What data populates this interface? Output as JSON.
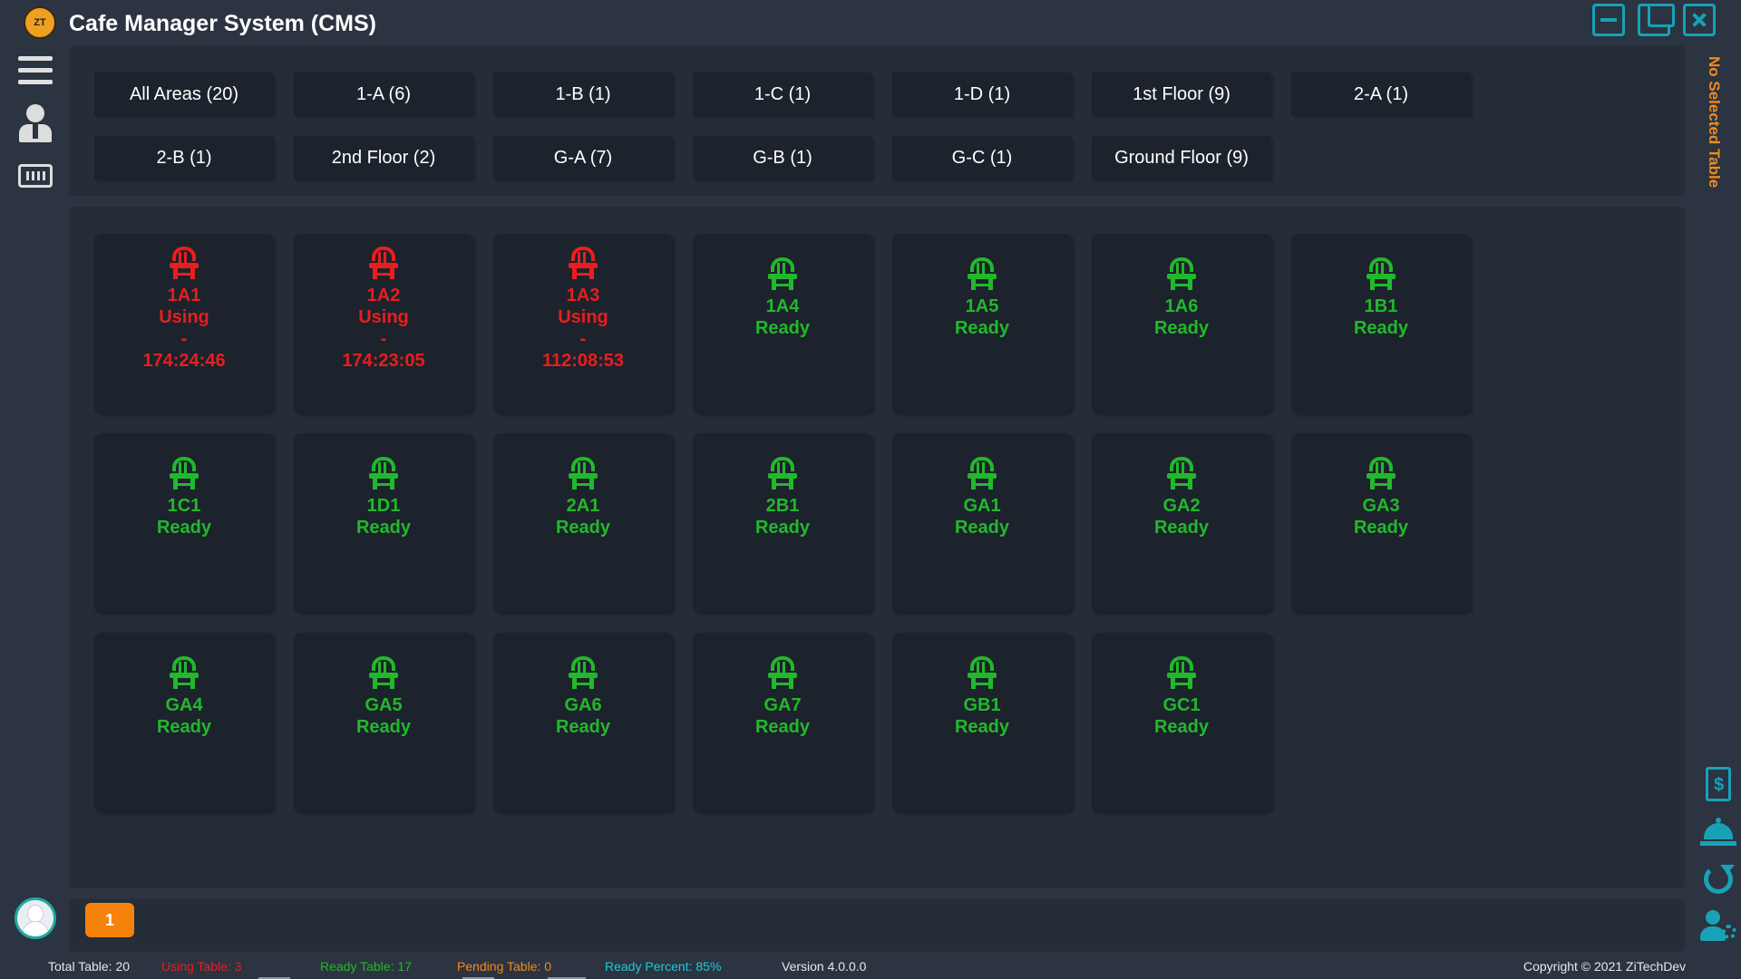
{
  "app": {
    "title": "Cafe Manager System (CMS)",
    "logo_text": "ZT"
  },
  "areas": [
    {
      "label": "All Areas (20)"
    },
    {
      "label": "1-A (6)"
    },
    {
      "label": "1-B (1)"
    },
    {
      "label": "1-C (1)"
    },
    {
      "label": "1-D (1)"
    },
    {
      "label": "1st Floor (9)"
    },
    {
      "label": "2-A (1)"
    },
    {
      "label": "2-B (1)"
    },
    {
      "label": "2nd Floor (2)"
    },
    {
      "label": "G-A (7)"
    },
    {
      "label": "G-B (1)"
    },
    {
      "label": "G-C (1)"
    },
    {
      "label": "Ground Floor (9)"
    }
  ],
  "tables": [
    {
      "name": "1A1",
      "status": "Using",
      "sep": "-",
      "time": "174:24:46"
    },
    {
      "name": "1A2",
      "status": "Using",
      "sep": "-",
      "time": "174:23:05"
    },
    {
      "name": "1A3",
      "status": "Using",
      "sep": "-",
      "time": "112:08:53"
    },
    {
      "name": "1A4",
      "status": "Ready"
    },
    {
      "name": "1A5",
      "status": "Ready"
    },
    {
      "name": "1A6",
      "status": "Ready"
    },
    {
      "name": "1B1",
      "status": "Ready"
    },
    {
      "name": "1C1",
      "status": "Ready"
    },
    {
      "name": "1D1",
      "status": "Ready"
    },
    {
      "name": "2A1",
      "status": "Ready"
    },
    {
      "name": "2B1",
      "status": "Ready"
    },
    {
      "name": "GA1",
      "status": "Ready"
    },
    {
      "name": "GA2",
      "status": "Ready"
    },
    {
      "name": "GA3",
      "status": "Ready"
    },
    {
      "name": "GA4",
      "status": "Ready"
    },
    {
      "name": "GA5",
      "status": "Ready"
    },
    {
      "name": "GA6",
      "status": "Ready"
    },
    {
      "name": "GA7",
      "status": "Ready"
    },
    {
      "name": "GB1",
      "status": "Ready"
    },
    {
      "name": "GC1",
      "status": "Ready"
    }
  ],
  "side": {
    "no_selected": "No Selected Table"
  },
  "pagination": {
    "current": "1"
  },
  "status_bar": {
    "total": "Total Table: 20",
    "using": "Using Table: 3",
    "ready": "Ready Table: 17",
    "pending": "Pending Table: 0",
    "percent": "Ready Percent: 85%",
    "version": "Version 4.0.0.0",
    "copyright": "Copyright © 2021 ZiTechDev"
  },
  "colors": {
    "using": "#e81e1e",
    "ready": "#22b82c",
    "accent": "#17a2b8",
    "orange": "#f5820a",
    "pending": "#f08a20",
    "percent": "#20c8d8"
  },
  "icons": [
    "app-logo-icon",
    "minimize-icon",
    "restore-icon",
    "close-icon",
    "menu-icon",
    "user-icon",
    "keyboard-icon",
    "chair-icon",
    "invoice-icon",
    "service-bell-icon",
    "refresh-icon",
    "user-settings-icon",
    "avatar-icon"
  ]
}
